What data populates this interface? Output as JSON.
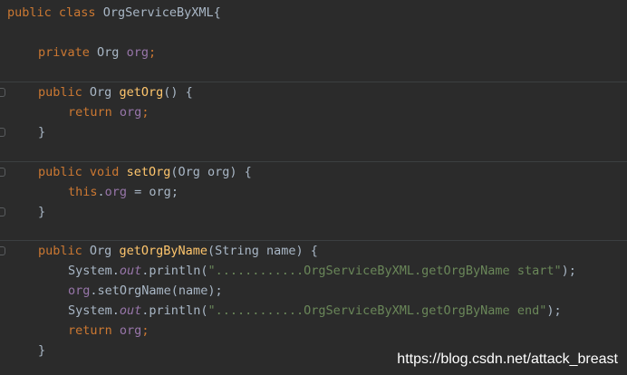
{
  "code": {
    "class_decl": {
      "public": "public",
      "class": "class",
      "name": "OrgServiceByXML{"
    },
    "field": {
      "private": "private",
      "type": "Org",
      "name": "org",
      "semi": ";"
    },
    "getOrg": {
      "public": "public",
      "type": "Org",
      "name": "getOrg",
      "rest": "() {",
      "return": "return",
      "value": "org",
      "semi": ";",
      "close": "}"
    },
    "setOrg": {
      "public": "public",
      "void": "void",
      "name": "setOrg",
      "params": "(Org org) {",
      "this": "this",
      "dot": ".",
      "field": "org",
      "assign": " = org;",
      "close": "}"
    },
    "getOrgByName": {
      "public": "public",
      "type": "Org",
      "name": "getOrgByName",
      "params": "(String name) {",
      "line1_prefix": "System.",
      "line1_out": "out",
      "line1_mid": ".println(",
      "line1_str": "\"............OrgServiceByXML.getOrgByName start\"",
      "line1_end": ");",
      "line2_obj": "org",
      "line2_rest": ".setOrgName(name);",
      "line3_prefix": "System.",
      "line3_out": "out",
      "line3_mid": ".println(",
      "line3_str": "\"............OrgServiceByXML.getOrgByName end\"",
      "line3_end": ");",
      "return": "return",
      "value": "org",
      "semi": ";",
      "close": "}"
    }
  },
  "watermark": "https://blog.csdn.net/attack_breast",
  "colors": {
    "background": "#2b2b2b",
    "keyword": "#cc7832",
    "function": "#ffc66d",
    "field": "#9876aa",
    "string": "#6a8759",
    "default": "#a9b7c6"
  }
}
